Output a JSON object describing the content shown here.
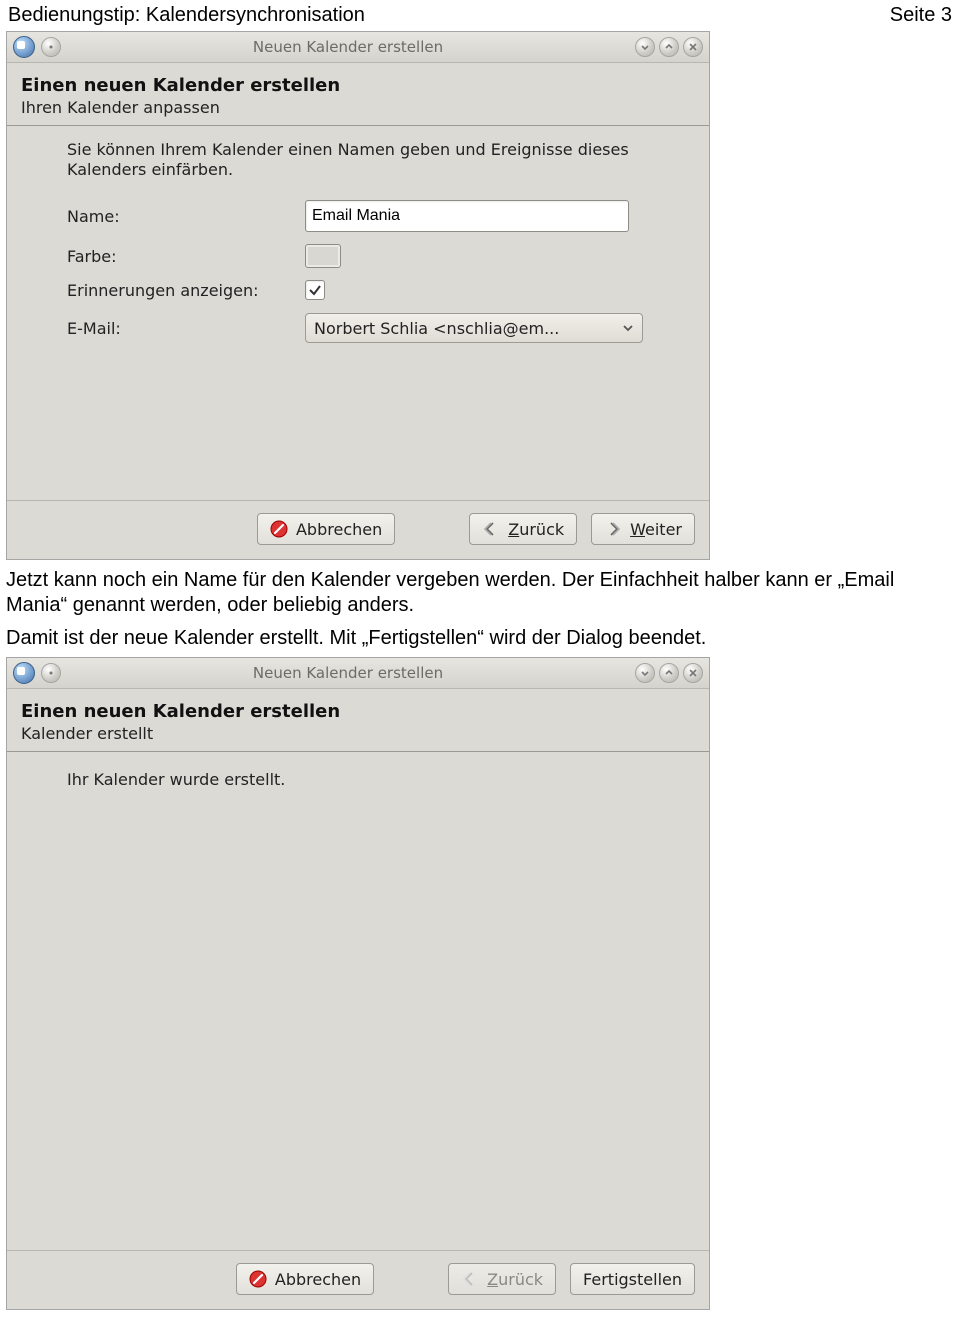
{
  "header": {
    "left": "Bedienungstip: Kalendersynchronisation",
    "right": "Seite 3"
  },
  "dialog1": {
    "windowTitle": "Neuen Kalender erstellen",
    "heading": "Einen neuen Kalender erstellen",
    "subheading": "Ihren Kalender anpassen",
    "description": "Sie können Ihrem Kalender einen Namen geben und Ereignisse dieses Kalenders einfärben.",
    "labels": {
      "name": "Name:",
      "color": "Farbe:",
      "reminders": "Erinnerungen anzeigen:",
      "email": "E-Mail:"
    },
    "values": {
      "name": "Email Mania",
      "email": "Norbert Schlia <nschlia@em..."
    },
    "buttons": {
      "cancel": "Abbrechen",
      "back_pre": "Z",
      "back_rest": "urück",
      "next_pre": "W",
      "next_rest": "eiter"
    }
  },
  "para1": "Jetzt kann noch ein Name für den Kalender vergeben werden. Der Einfachheit halber kann er „Email Mania“ genannt werden, oder beliebig anders.",
  "para2": "Damit ist der neue Kalender erstellt. Mit „Fertigstellen“ wird der Dialog beendet.",
  "dialog2": {
    "windowTitle": "Neuen Kalender erstellen",
    "heading": "Einen neuen Kalender erstellen",
    "subheading": "Kalender erstellt",
    "message": "Ihr Kalender wurde erstellt.",
    "buttons": {
      "cancel": "Abbrechen",
      "back_pre": "Z",
      "back_rest": "urück",
      "finish": "Fertigstellen"
    }
  }
}
